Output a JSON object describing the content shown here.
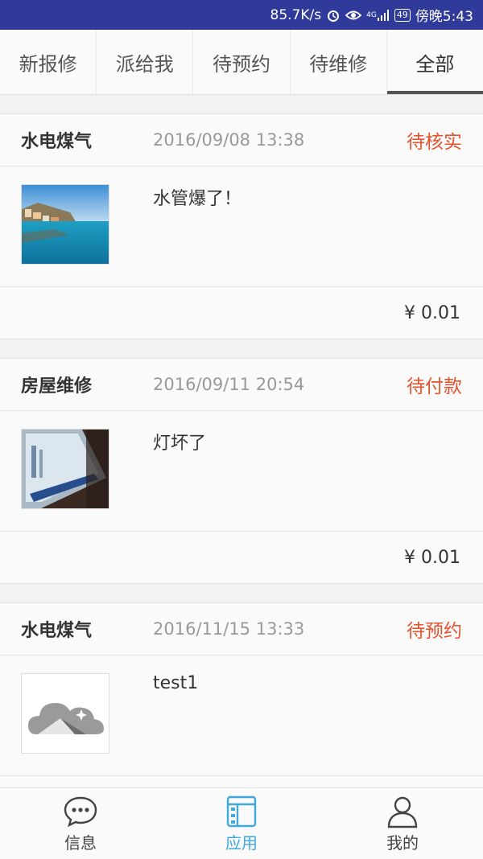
{
  "status_bar": {
    "speed": "85.7K/s",
    "battery": "49",
    "time": "傍晚5:43",
    "signal": "4G"
  },
  "tabs": [
    {
      "label": "新报修"
    },
    {
      "label": "派给我"
    },
    {
      "label": "待预约"
    },
    {
      "label": "待维修"
    },
    {
      "label": "全部",
      "active": true
    }
  ],
  "orders": [
    {
      "category": "水电煤气",
      "time": "2016/09/08 13:38",
      "status": "待核实",
      "description": "水管爆了！",
      "price": "¥ 0.01",
      "image": "coast-photo"
    },
    {
      "category": "房屋维修",
      "time": "2016/09/11 20:54",
      "status": "待付款",
      "description": "灯坏了",
      "price": "¥ 0.01",
      "image": "screen-photo"
    },
    {
      "category": "水电煤气",
      "time": "2016/11/15 13:33",
      "status": "待预约",
      "description": "test1",
      "image": "placeholder-cloud"
    }
  ],
  "bottom_nav": [
    {
      "label": "信息",
      "icon": "chat-icon"
    },
    {
      "label": "应用",
      "icon": "app-icon",
      "active": true
    },
    {
      "label": "我的",
      "icon": "user-icon"
    }
  ],
  "colors": {
    "status_bar": "#2f3a9a",
    "accent": "#3fa9dc",
    "status_text": "#e5532e"
  }
}
